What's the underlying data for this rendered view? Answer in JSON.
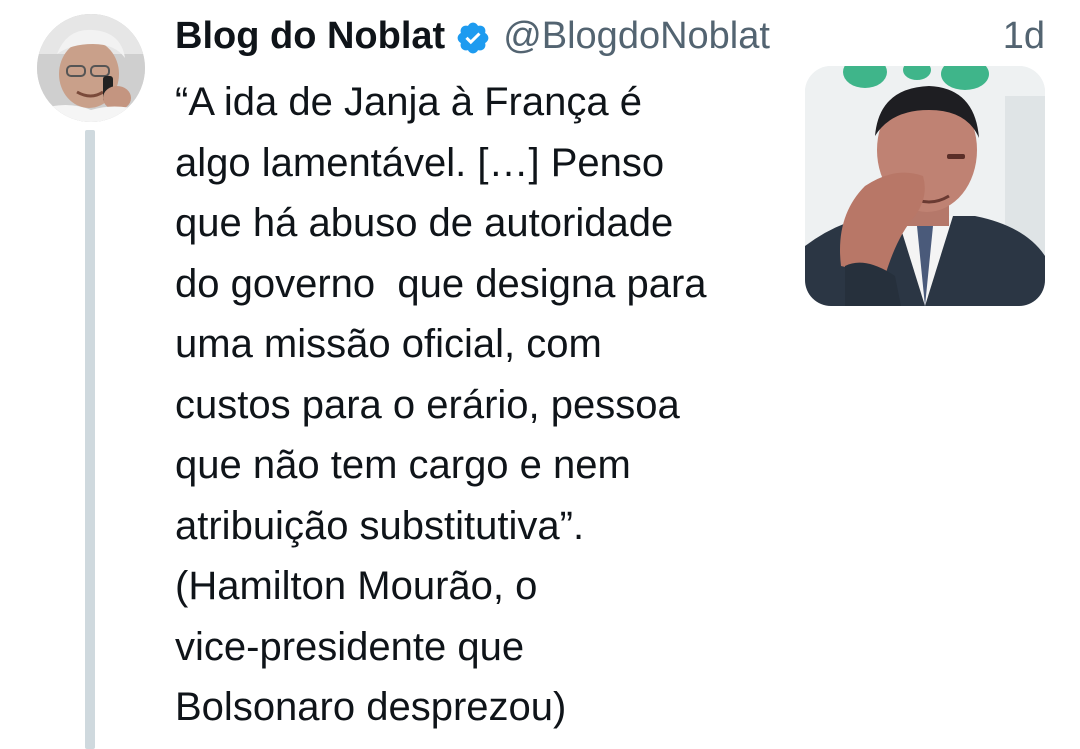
{
  "author": {
    "display_name": "Blog do Noblat",
    "handle": "@BlogdoNoblat",
    "verified_icon": "verified-badge-icon",
    "avatar": "author-avatar-photo"
  },
  "tweet": {
    "timestamp": "1d",
    "lines": [
      "“A ida de Janja à França é",
      "algo lamentável. […] Penso",
      "que há abuso de autoridade",
      "do governo  que designa para",
      "uma missão oficial, com",
      "custos para o erário, pessoa",
      "que não tem cargo e nem",
      "atribuição substitutiva”.",
      "(Hamilton Mourão, o",
      "vice-presidente que",
      "Bolsonaro desprezou)"
    ],
    "media": "attached-photo"
  },
  "colors": {
    "text": "#0f1419",
    "secondary": "#536471",
    "verified": "#1d9bf0",
    "thread_line": "#cfd9de"
  }
}
